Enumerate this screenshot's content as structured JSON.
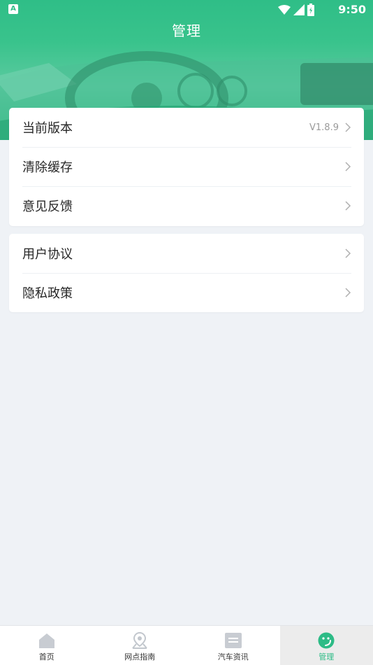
{
  "status_bar": {
    "notification_icon": "A",
    "time": "9:50",
    "icons": [
      "wifi-icon",
      "signal-icon",
      "battery-icon"
    ]
  },
  "header": {
    "title": "管理"
  },
  "settings_group_1": {
    "items": [
      {
        "label": "当前版本",
        "value": "V1.8.9"
      },
      {
        "label": "清除缓存"
      },
      {
        "label": "意见反馈"
      }
    ]
  },
  "settings_group_2": {
    "items": [
      {
        "label": "用户协议"
      },
      {
        "label": "隐私政策"
      }
    ]
  },
  "bottom_nav": {
    "items": [
      {
        "label": "首页",
        "icon": "home-icon"
      },
      {
        "label": "网点指南",
        "icon": "map-pin-icon"
      },
      {
        "label": "汽车资讯",
        "icon": "news-icon"
      },
      {
        "label": "管理",
        "icon": "smile-icon",
        "active": true
      }
    ]
  },
  "colors": {
    "brand": "#2fbe87",
    "active_label": "#2dbb86",
    "background": "#eff2f6"
  }
}
